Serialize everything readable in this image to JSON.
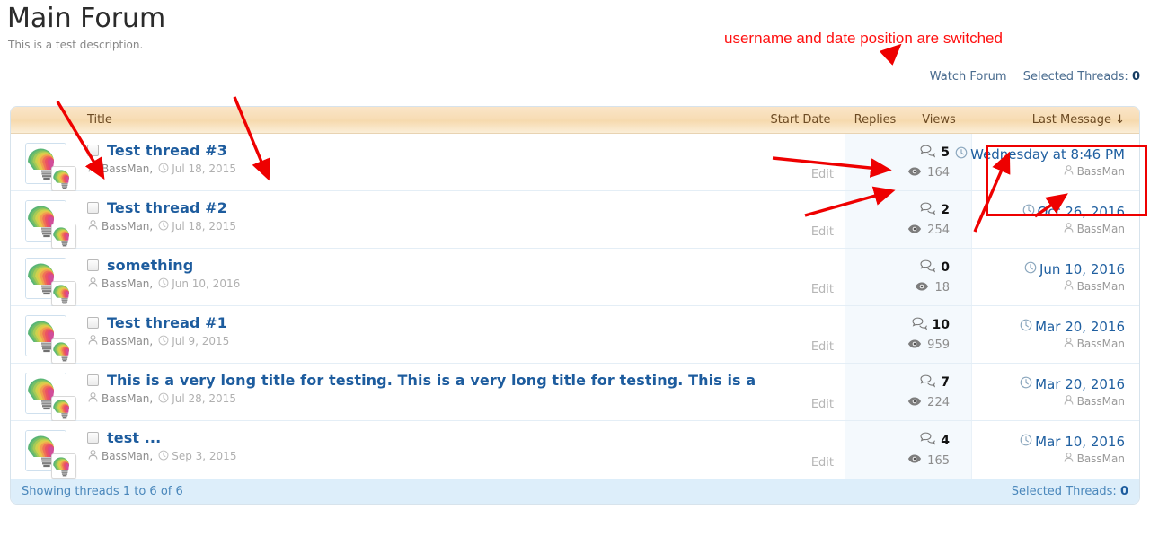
{
  "header": {
    "title": "Main Forum",
    "description": "This is a test description."
  },
  "top_links": {
    "watch_forum": "Watch Forum",
    "selected_threads_label": "Selected Threads:",
    "selected_threads_count": "0"
  },
  "table": {
    "columns": {
      "title": "Title",
      "start_date": "Start Date",
      "replies": "Replies",
      "views": "Views",
      "last_message": "Last Message ↓"
    },
    "edit_label": "Edit",
    "rows": [
      {
        "title": "Test thread #3",
        "author": "BassMan,",
        "start_date": "Jul 18, 2015",
        "replies": "5",
        "views": "164",
        "last_message_date": "Wednesday at 8:46 PM",
        "last_message_user": "BassMan"
      },
      {
        "title": "Test thread #2",
        "author": "BassMan,",
        "start_date": "Jul 18, 2015",
        "replies": "2",
        "views": "254",
        "last_message_date": "Oct 26, 2016",
        "last_message_user": "BassMan"
      },
      {
        "title": "something",
        "author": "BassMan,",
        "start_date": "Jun 10, 2016",
        "replies": "0",
        "views": "18",
        "last_message_date": "Jun 10, 2016",
        "last_message_user": "BassMan"
      },
      {
        "title": "Test thread #1",
        "author": "BassMan,",
        "start_date": "Jul 9, 2015",
        "replies": "10",
        "views": "959",
        "last_message_date": "Mar 20, 2016",
        "last_message_user": "BassMan"
      },
      {
        "title": "This is a very long title for testing. This is a very long title for testing. This is a very long ti",
        "author": "BassMan,",
        "start_date": "Jul 28, 2015",
        "replies": "7",
        "views": "224",
        "last_message_date": "Mar 20, 2016",
        "last_message_user": "BassMan"
      },
      {
        "title": "test ...",
        "author": "BassMan,",
        "start_date": "Sep 3, 2015",
        "replies": "4",
        "views": "165",
        "last_message_date": "Mar 10, 2016",
        "last_message_user": "BassMan"
      }
    ]
  },
  "footer": {
    "showing": "Showing threads 1 to 6 of 6",
    "selected_threads_label": "Selected Threads:",
    "selected_threads_count": "0"
  },
  "annotation": {
    "note": "username and date position are switched",
    "color": "#ee0000"
  },
  "icons": {
    "clock": "clock-icon",
    "user": "user-icon",
    "reply": "speech-bubbles-icon",
    "eye": "eye-icon"
  }
}
